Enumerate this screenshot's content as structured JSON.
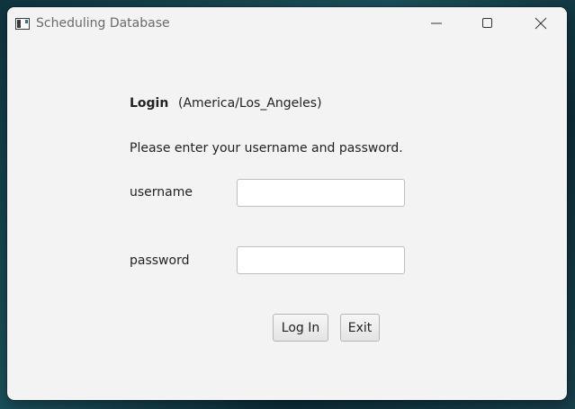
{
  "window": {
    "title": "Scheduling Database",
    "controls": {
      "minimize_icon": "minimize-icon",
      "maximize_icon": "maximize-icon",
      "close_icon": "close-icon"
    }
  },
  "login": {
    "title": "Login",
    "timezone": "(America/Los_Angeles)",
    "prompt": "Please enter your username and password.",
    "username_label": "username",
    "username_value": "",
    "password_label": "password",
    "password_value": "",
    "login_button": "Log In",
    "exit_button": "Exit"
  }
}
